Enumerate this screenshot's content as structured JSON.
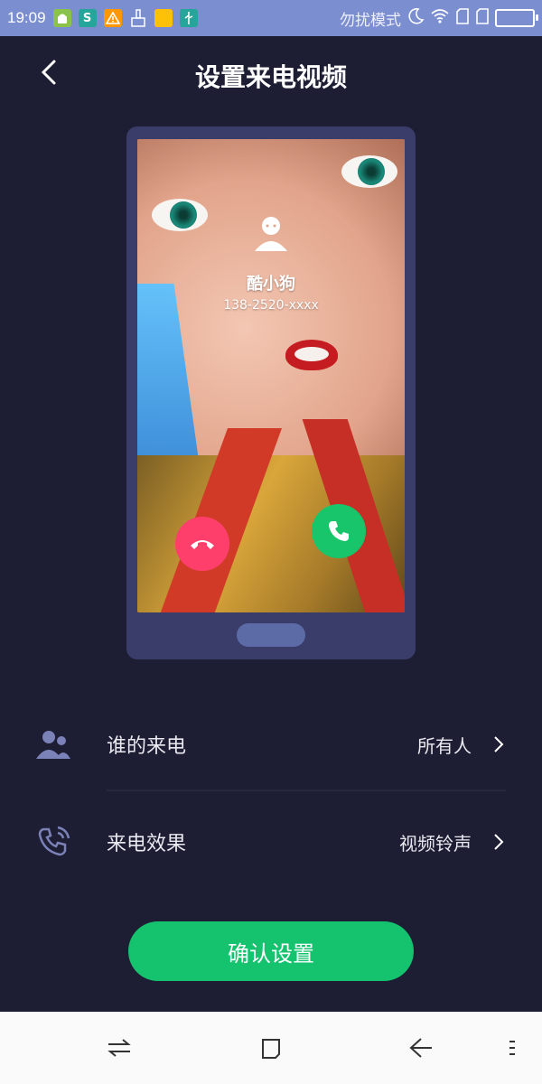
{
  "status_bar": {
    "time": "19:09",
    "dnd_text": "勿扰模式"
  },
  "header": {
    "title": "设置来电视频",
    "back_icon": "chevron-left-icon"
  },
  "preview": {
    "caller_name": "酷小狗",
    "caller_number": "138-2520-xxxx",
    "decline_icon": "hangup-icon",
    "accept_icon": "phone-icon",
    "decline_color": "#ff3f6b",
    "accept_color": "#18c56b"
  },
  "settings": [
    {
      "label": "谁的来电",
      "value": "所有人",
      "icon": "contacts-icon"
    },
    {
      "label": "来电效果",
      "value": "视频铃声",
      "icon": "ringing-phone-icon"
    }
  ],
  "confirm_button": {
    "label": "确认设置",
    "color": "#15c26e"
  },
  "nav_bar": {
    "items": [
      "switch-apps-icon",
      "home-square-icon",
      "back-arrow-icon",
      "menu-icon"
    ]
  }
}
